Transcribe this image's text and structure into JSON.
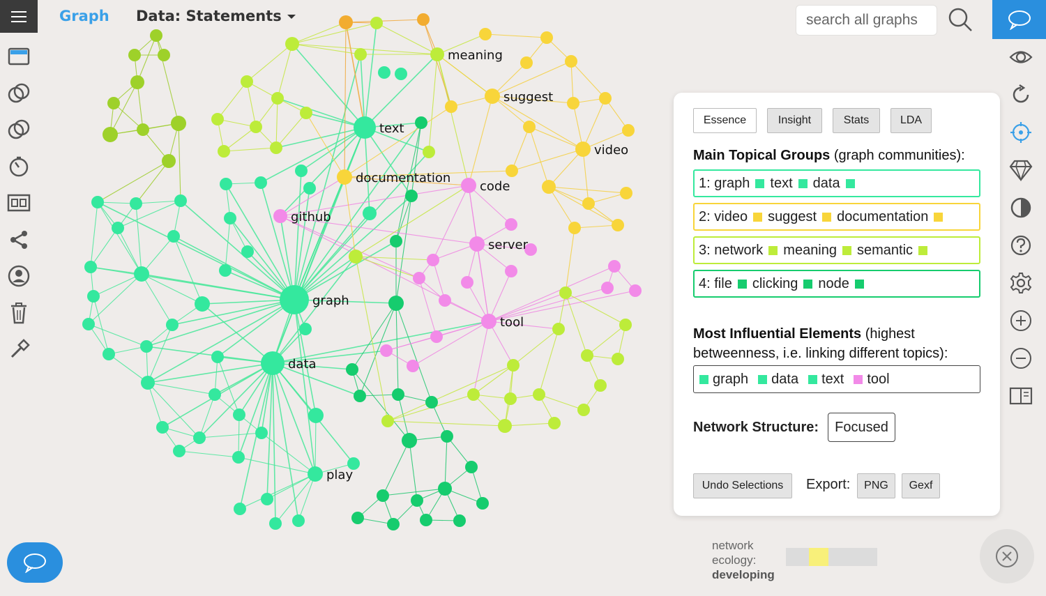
{
  "header": {
    "tab_graph": "Graph",
    "data_select": "Data: Statements"
  },
  "search": {
    "placeholder": "search all graphs"
  },
  "left_toolbar": [
    "window-icon",
    "overlap-icon",
    "overlap-alt-icon",
    "timer-icon",
    "film-icon",
    "share-icon",
    "user-icon",
    "trash-icon",
    "pen-icon"
  ],
  "right_toolbar": [
    "eye-icon",
    "refresh-icon",
    "target-icon",
    "diamond-icon",
    "contrast-icon",
    "help-icon",
    "settings-icon",
    "zoom-in-icon",
    "zoom-out-icon",
    "book-icon"
  ],
  "colors": {
    "green": "#34e89e",
    "dark_green": "#16cc6e",
    "yellow_green": "#bdec3a",
    "yellow": "#f8d53a",
    "orange": "#f2ac30",
    "pink": "#f28ae8",
    "olive": "#9ed12a",
    "accent": "#2a8fde"
  },
  "graph": {
    "labels": {
      "meaning": "meaning",
      "suggest": "suggest",
      "text": "text",
      "video": "video",
      "documentation": "documentation",
      "code": "code",
      "github": "github",
      "server": "server",
      "graph": "graph",
      "tool": "tool",
      "data": "data",
      "play": "play"
    }
  },
  "panel": {
    "tabs": [
      "Essence",
      "Insight",
      "Stats",
      "LDA"
    ],
    "topical_title_bold": "Main Topical Groups",
    "topical_title_rest": " (graph communities):",
    "groups": [
      {
        "num": "1:",
        "words": [
          "graph",
          "text",
          "data"
        ],
        "color": "#34e89e"
      },
      {
        "num": "2:",
        "words": [
          "video",
          "suggest",
          "documentation"
        ],
        "color": "#f8d53a"
      },
      {
        "num": "3:",
        "words": [
          "network",
          "meaning",
          "semantic"
        ],
        "color": "#bdec3a"
      },
      {
        "num": "4:",
        "words": [
          "file",
          "clicking",
          "node"
        ],
        "color": "#16cc6e"
      }
    ],
    "influential_bold": "Most Influential Elements",
    "influential_rest_1": " (highest",
    "influential_rest_2": "betweenness, i.e. linking different topics):",
    "influential": [
      {
        "word": "graph",
        "color": "#34e89e"
      },
      {
        "word": "data",
        "color": "#34e89e"
      },
      {
        "word": "text",
        "color": "#34e89e"
      },
      {
        "word": "tool",
        "color": "#f28ae8"
      }
    ],
    "structure_label": "Network Structure:",
    "structure_value": "Focused",
    "undo_label": "Undo Selections",
    "export_label": "Export:",
    "export_png": "PNG",
    "export_gexf": "Gexf"
  },
  "ecology": {
    "line1": "network",
    "line2": "ecology:",
    "status": "developing",
    "level": 0.25,
    "color": "#f8f07a"
  }
}
